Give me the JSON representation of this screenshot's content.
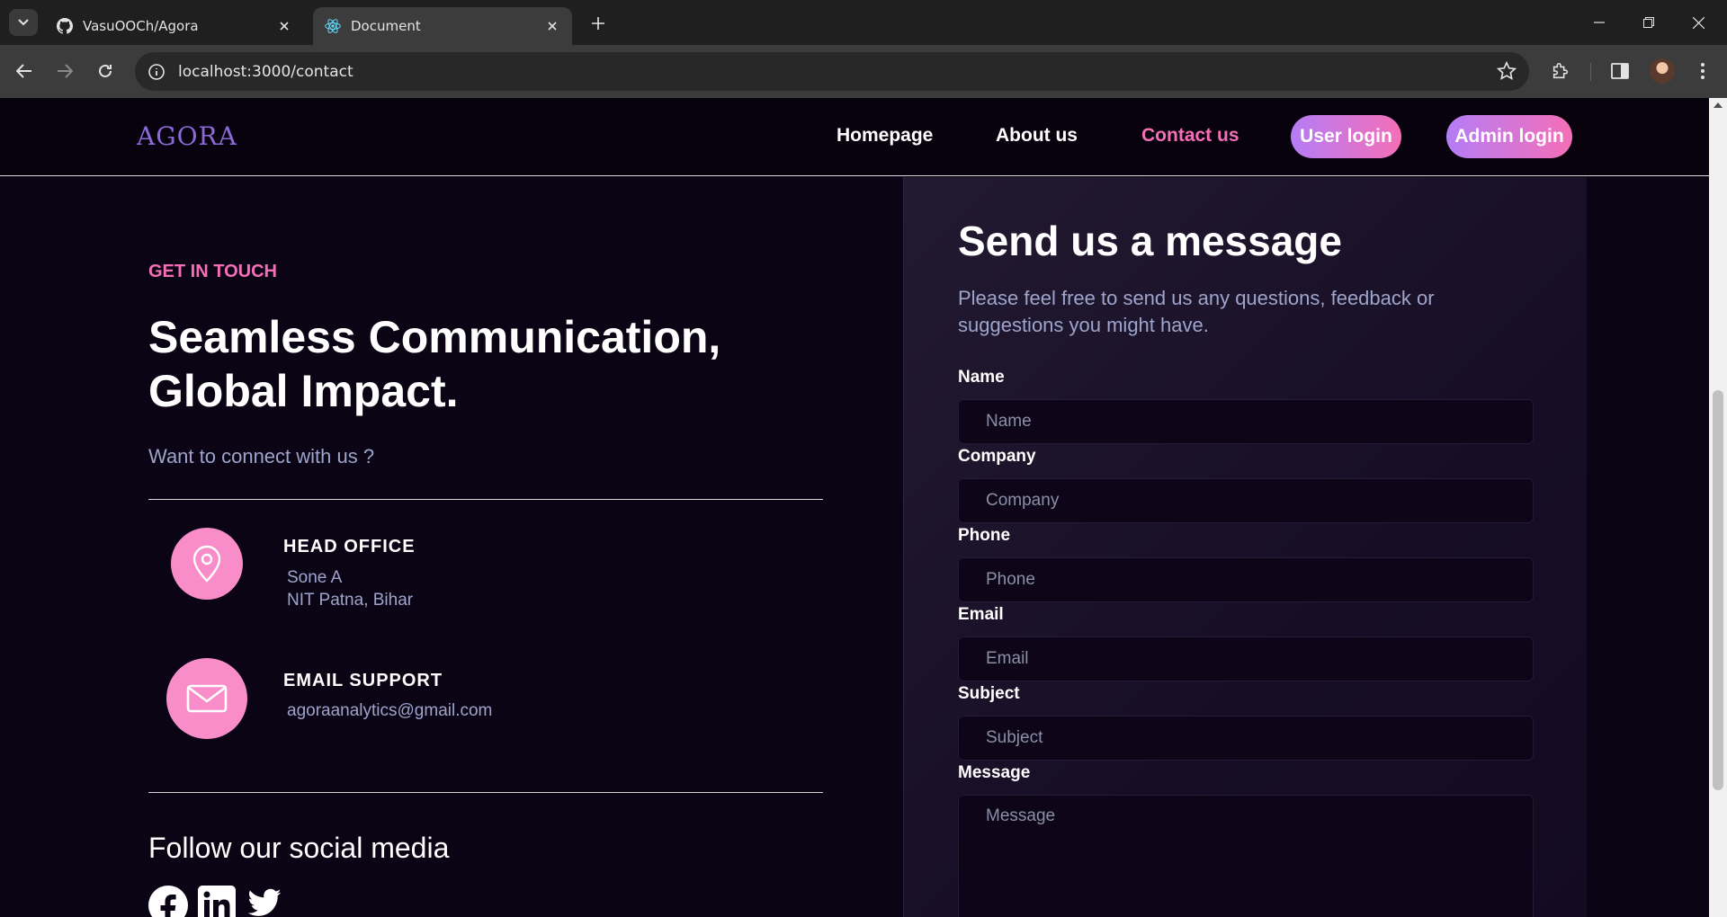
{
  "browser": {
    "tabs": [
      {
        "title": "VasuOOCh/Agora",
        "active": false,
        "icon": "github-icon"
      },
      {
        "title": "Document",
        "active": true,
        "icon": "react-icon"
      }
    ],
    "url": "localhost:3000/contact"
  },
  "nav": {
    "logo": "AGORA",
    "links": [
      "Homepage",
      "About us",
      "Contact us"
    ],
    "active_link": "Contact us",
    "user_login": "User login",
    "admin_login": "Admin login"
  },
  "contact": {
    "eyebrow": "GET IN TOUCH",
    "headline": "Seamless Communication, Global Impact.",
    "sub": "Want to connect with us ?",
    "head_office": {
      "title": "HEAD OFFICE",
      "line1": "Sone A",
      "line2": "NIT Patna, Bihar",
      "icon": "location-pin-icon"
    },
    "email_support": {
      "title": "EMAIL SUPPORT",
      "email": "agoraanalytics@gmail.com",
      "icon": "mail-icon"
    },
    "follow": "Follow our social media",
    "socials": [
      "facebook-icon",
      "linkedin-icon",
      "twitter-icon"
    ]
  },
  "form": {
    "title": "Send us a message",
    "desc": "Please feel free to send us any questions, feedback or suggestions you might have.",
    "fields": {
      "name": {
        "label": "Name",
        "placeholder": "Name"
      },
      "company": {
        "label": "Company",
        "placeholder": "Company"
      },
      "phone": {
        "label": "Phone",
        "placeholder": "Phone"
      },
      "email": {
        "label": "Email",
        "placeholder": "Email"
      },
      "subject": {
        "label": "Subject",
        "placeholder": "Subject"
      },
      "message": {
        "label": "Message",
        "placeholder": "Message"
      }
    }
  },
  "colors": {
    "accent_pink": "#f56fb6",
    "accent_purple": "#b57cf5",
    "background": "#0b0414"
  }
}
